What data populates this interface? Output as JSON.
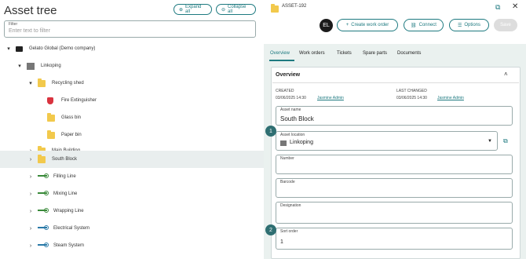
{
  "left": {
    "title": "Asset tree",
    "expand_all": "Expand all",
    "collapse_all": "Collapse all",
    "filter": {
      "label": "Filter",
      "placeholder": "Enter text to filter"
    },
    "tree": [
      {
        "label": "Gelato Global (Demo company)",
        "icon": "briefcase-icon",
        "chevron": "▾"
      },
      {
        "label": "Linkoping",
        "icon": "building-icon",
        "chevron": "▾"
      },
      {
        "label": "Recycling shed",
        "icon": "folder-icon",
        "chevron": "▾"
      },
      {
        "label": "Fire Extinguisher",
        "icon": "shield-icon",
        "chevron": ""
      },
      {
        "label": "Glass bin",
        "icon": "folder-icon",
        "chevron": ""
      },
      {
        "label": "Paper bin",
        "icon": "folder-icon",
        "chevron": ""
      },
      {
        "label": "Main Building",
        "icon": "folder-icon",
        "chevron": "›"
      },
      {
        "label": "South Block",
        "icon": "folder-icon",
        "chevron": "›"
      },
      {
        "label": "Filling Line",
        "icon": "line-icon",
        "chevron": "›"
      },
      {
        "label": "Mixing Line",
        "icon": "line-icon",
        "chevron": "›"
      },
      {
        "label": "Wrapping Line",
        "icon": "line-icon",
        "chevron": "›"
      },
      {
        "label": "Electrical System",
        "icon": "line-icon",
        "chevron": "›"
      },
      {
        "label": "Steam System",
        "icon": "line-icon",
        "chevron": "›"
      }
    ]
  },
  "right": {
    "asset_id": "ASSET-192",
    "avatar": "EL",
    "buttons": {
      "create": "Create work order",
      "connect": "Connect",
      "options": "Options",
      "save": "Save"
    },
    "tabs": [
      "Overview",
      "Work orders",
      "Tickets",
      "Spare parts",
      "Documents"
    ],
    "panel": {
      "title": "Overview",
      "created_label": "CREATED",
      "created_date": "03/06/2025  14:30",
      "created_by": "Jasmine Admin",
      "changed_label": "LAST CHANGED",
      "changed_date": "03/06/2025  14:30",
      "changed_by": "Jasmine Admin",
      "fields": {
        "asset_name": {
          "label": "Asset name",
          "value": "South Block"
        },
        "location": {
          "label": "Asset location",
          "value": "Linkoping"
        },
        "number": {
          "label": "Number",
          "value": ""
        },
        "barcode": {
          "label": "Barcode",
          "value": ""
        },
        "designation": {
          "label": "Designation",
          "value": ""
        },
        "sort_order": {
          "label": "Sort order",
          "value": "1"
        }
      }
    },
    "badges": [
      "1",
      "2"
    ]
  }
}
